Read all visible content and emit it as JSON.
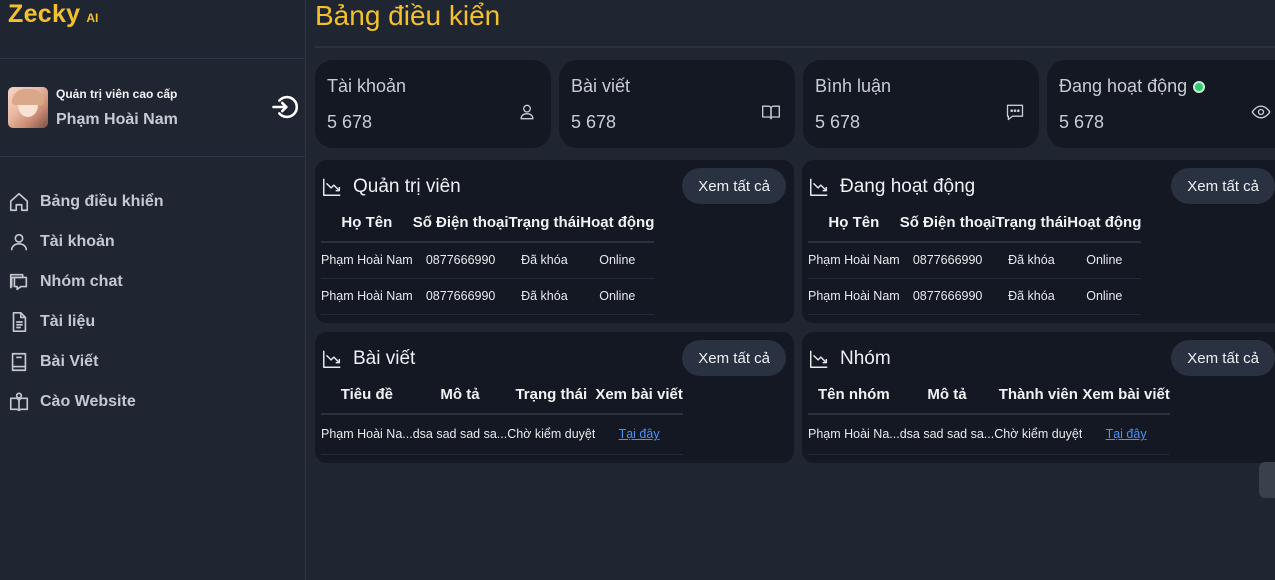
{
  "brand": {
    "name": "Zecky",
    "suffix": "AI",
    "accent": "#f3c12b"
  },
  "profile": {
    "role": "Quản trị viên cao cấp",
    "name": "Phạm Hoài Nam"
  },
  "nav": [
    {
      "label": "Bảng điều khiển",
      "icon": "home-icon"
    },
    {
      "label": "Tài khoản",
      "icon": "user-icon"
    },
    {
      "label": "Nhóm chat",
      "icon": "chat-icon"
    },
    {
      "label": "Tài liệu",
      "icon": "document-icon"
    },
    {
      "label": "Bài Viết",
      "icon": "book-icon"
    },
    {
      "label": "Cào Website",
      "icon": "open-book-icon"
    }
  ],
  "page": {
    "title": "Bảng điều kiển"
  },
  "stats": [
    {
      "label": "Tài khoản",
      "value": "5 678",
      "icon": "user-icon"
    },
    {
      "label": "Bài viết",
      "value": "5 678",
      "icon": "book-icon"
    },
    {
      "label": "Bình luận",
      "value": "5 678",
      "icon": "comment-icon"
    },
    {
      "label": "Đang hoạt động",
      "value": "5 678",
      "icon": "eye-icon",
      "status_color": "#2ecc71"
    }
  ],
  "panels": {
    "admins": {
      "title": "Quản trị viên",
      "see_all": "Xem tất cả",
      "columns": [
        "Họ Tên",
        "Số Điện thoại",
        "Trạng thái",
        "Hoạt động"
      ],
      "rows": [
        [
          "Phạm Hoài Nam",
          "0877666990",
          "Đã khóa",
          "Online"
        ],
        [
          "Phạm Hoài Nam",
          "0877666990",
          "Đã khóa",
          "Online"
        ]
      ]
    },
    "active": {
      "title": "Đang hoạt động",
      "see_all": "Xem tất cả",
      "columns": [
        "Họ Tên",
        "Số Điện thoại",
        "Trạng thái",
        "Hoạt động"
      ],
      "rows": [
        [
          "Phạm Hoài Nam",
          "0877666990",
          "Đã khóa",
          "Online"
        ],
        [
          "Phạm Hoài Nam",
          "0877666990",
          "Đã khóa",
          "Online"
        ]
      ]
    },
    "posts": {
      "title": "Bài viết",
      "see_all": "Xem tất cả",
      "columns": [
        "Tiêu đề",
        "Mô tả",
        "Trạng thái",
        "Xem bài viết"
      ],
      "rows": [
        [
          "Phạm Hoài Na...",
          "dsa sad sad sa...",
          "Chờ kiểm duyệt",
          "Tại đây"
        ]
      ]
    },
    "groups": {
      "title": "Nhóm",
      "see_all": "Xem tất cả",
      "columns": [
        "Tên nhóm",
        "Mô tả",
        "Thành viên",
        "Xem bài viết"
      ],
      "rows": [
        [
          "Phạm Hoài Na...",
          "dsa sad sad sa...",
          "Chờ kiểm duyệt",
          "Tại đây"
        ]
      ]
    }
  }
}
